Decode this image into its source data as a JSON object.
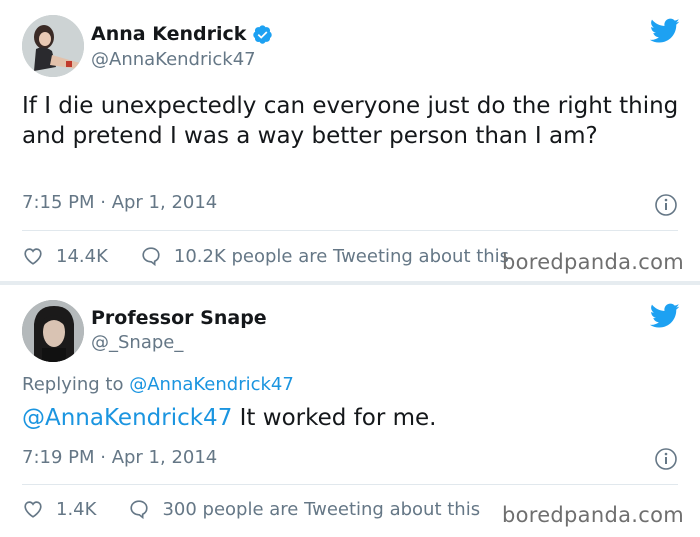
{
  "tweet1": {
    "display_name": "Anna Kendrick",
    "handle": "@AnnaKendrick47",
    "text": "If I die unexpectedly can everyone just do the right thing and pretend I was a way better person than I am?",
    "timestamp": "7:15 PM · Apr 1, 2014",
    "likes": "14.4K",
    "tweeting": "10.2K people are Tweeting about this",
    "watermark": "boredpanda.com"
  },
  "tweet2": {
    "display_name": "Professor Snape",
    "handle": "@_Snape_",
    "replying_label": "Replying to",
    "replying_to": "@AnnaKendrick47",
    "mention": "@AnnaKendrick47",
    "text": " It worked for me.",
    "timestamp": "7:19 PM · Apr 1, 2014",
    "likes": "1.4K",
    "tweeting": "300 people are Tweeting about this",
    "watermark": "boredpanda.com"
  },
  "colors": {
    "twitter_blue": "#1da1f2",
    "link": "#1b95e0",
    "muted": "#657786",
    "background": "#e6ecf0"
  },
  "icons": [
    "verified-badge-icon",
    "twitter-bird-icon",
    "info-icon",
    "heart-icon",
    "speech-bubble-icon"
  ]
}
